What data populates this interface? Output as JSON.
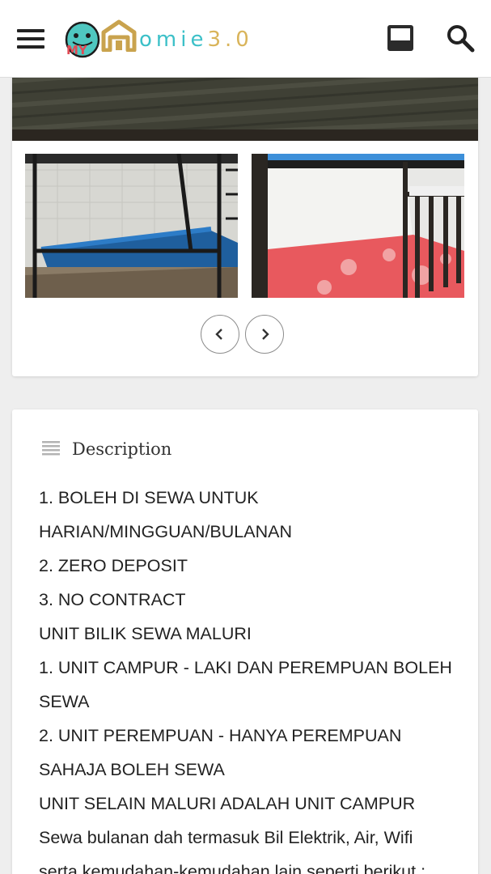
{
  "header": {
    "brand_my": "MY",
    "brand_text": "omie",
    "brand_version": "3.0",
    "icons": [
      "menu-icon",
      "inbox-icon",
      "search-icon"
    ]
  },
  "gallery": {
    "thumbnails": [
      {
        "subject": "bunk bed with blue mattress"
      },
      {
        "subject": "bunk bed with pink floral mattress"
      }
    ],
    "nav_icons": [
      "chevron-left-icon",
      "chevron-right-icon"
    ]
  },
  "description": {
    "title": "Description",
    "lines": [
      "1. BOLEH DI SEWA UNTUK",
      "HARIAN/MINGGUAN/BULANAN",
      "2. ZERO DEPOSIT",
      "3. NO CONTRACT",
      "UNIT BILIK SEWA MALURI",
      "1. UNIT CAMPUR - LAKI DAN PEREMPUAN BOLEH",
      "SEWA",
      "2. UNIT PEREMPUAN - HANYA PEREMPUAN",
      "SAHAJA BOLEH SEWA",
      "UNIT SELAIN MALURI ADALAH UNIT CAMPUR",
      "Sewa bulanan dah termasuk Bil Elektrik, Air, Wifi",
      "serta kemudahan-kemudahan lain seperti berikut :"
    ]
  },
  "colors": {
    "brand_teal": "#3cc0c8",
    "brand_gold": "#d9b45a",
    "background": "#eeeeee"
  }
}
